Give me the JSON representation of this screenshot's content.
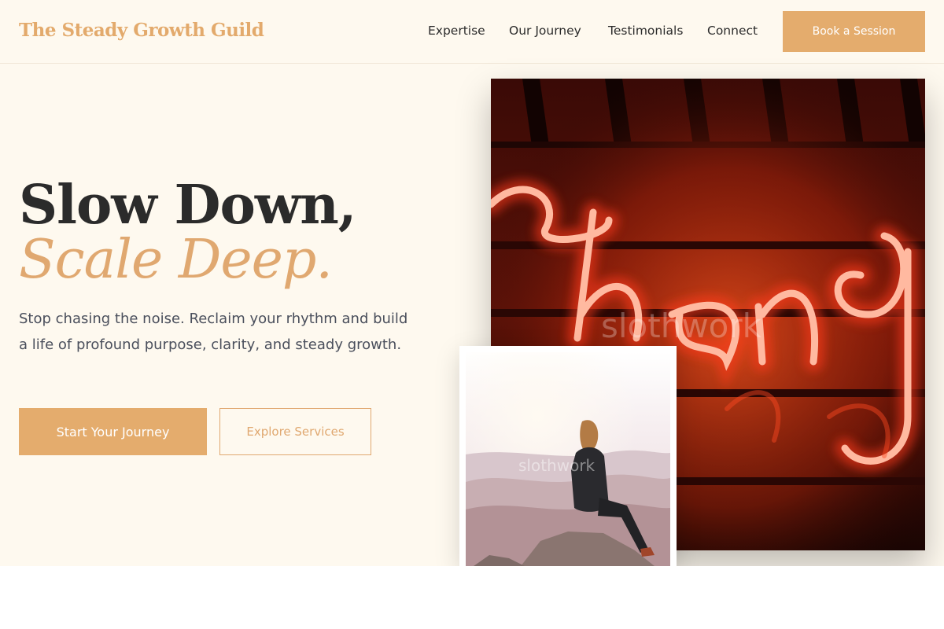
{
  "header": {
    "brand": "The Steady Growth Guild",
    "nav": [
      "Expertise",
      "Our Journey",
      "Testimonials",
      "Connect"
    ],
    "cta": "Book a Session"
  },
  "hero": {
    "headline_line1": "Slow Down,",
    "headline_line2": "Scale Deep.",
    "subtext": "Stop chasing the noise. Reclaim your rhythm and build a life of profound purpose, clarity, and steady growth.",
    "primary_cta": "Start Your Journey",
    "secondary_cta": "Explore Services"
  },
  "images": {
    "main_alt": "neon sign",
    "secondary_alt": "person sitting on mountain rock",
    "watermark": "slothwork"
  },
  "colors": {
    "accent": "#e4ac6d",
    "background": "#fef9ef",
    "text": "#2b2b2b"
  }
}
